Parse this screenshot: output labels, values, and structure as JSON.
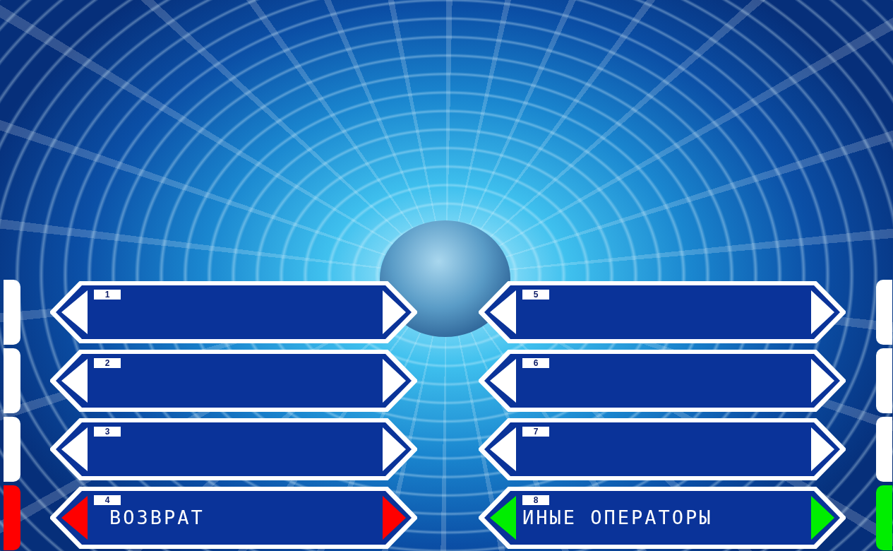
{
  "options": [
    {
      "number": "1",
      "color": "#ffffff"
    },
    {
      "number": "2",
      "color": "#ffffff"
    },
    {
      "number": "3",
      "color": "#ffffff"
    },
    {
      "number": "4",
      "label": "ВОЗВРАТ",
      "color": "#ff0000"
    },
    {
      "number": "5",
      "color": "#ffffff"
    },
    {
      "number": "6",
      "color": "#ffffff"
    },
    {
      "number": "7",
      "color": "#ffffff"
    },
    {
      "number": "8",
      "label": "ИНЫЕ ОПЕРАТОРЫ",
      "color": "#00ee00"
    }
  ]
}
